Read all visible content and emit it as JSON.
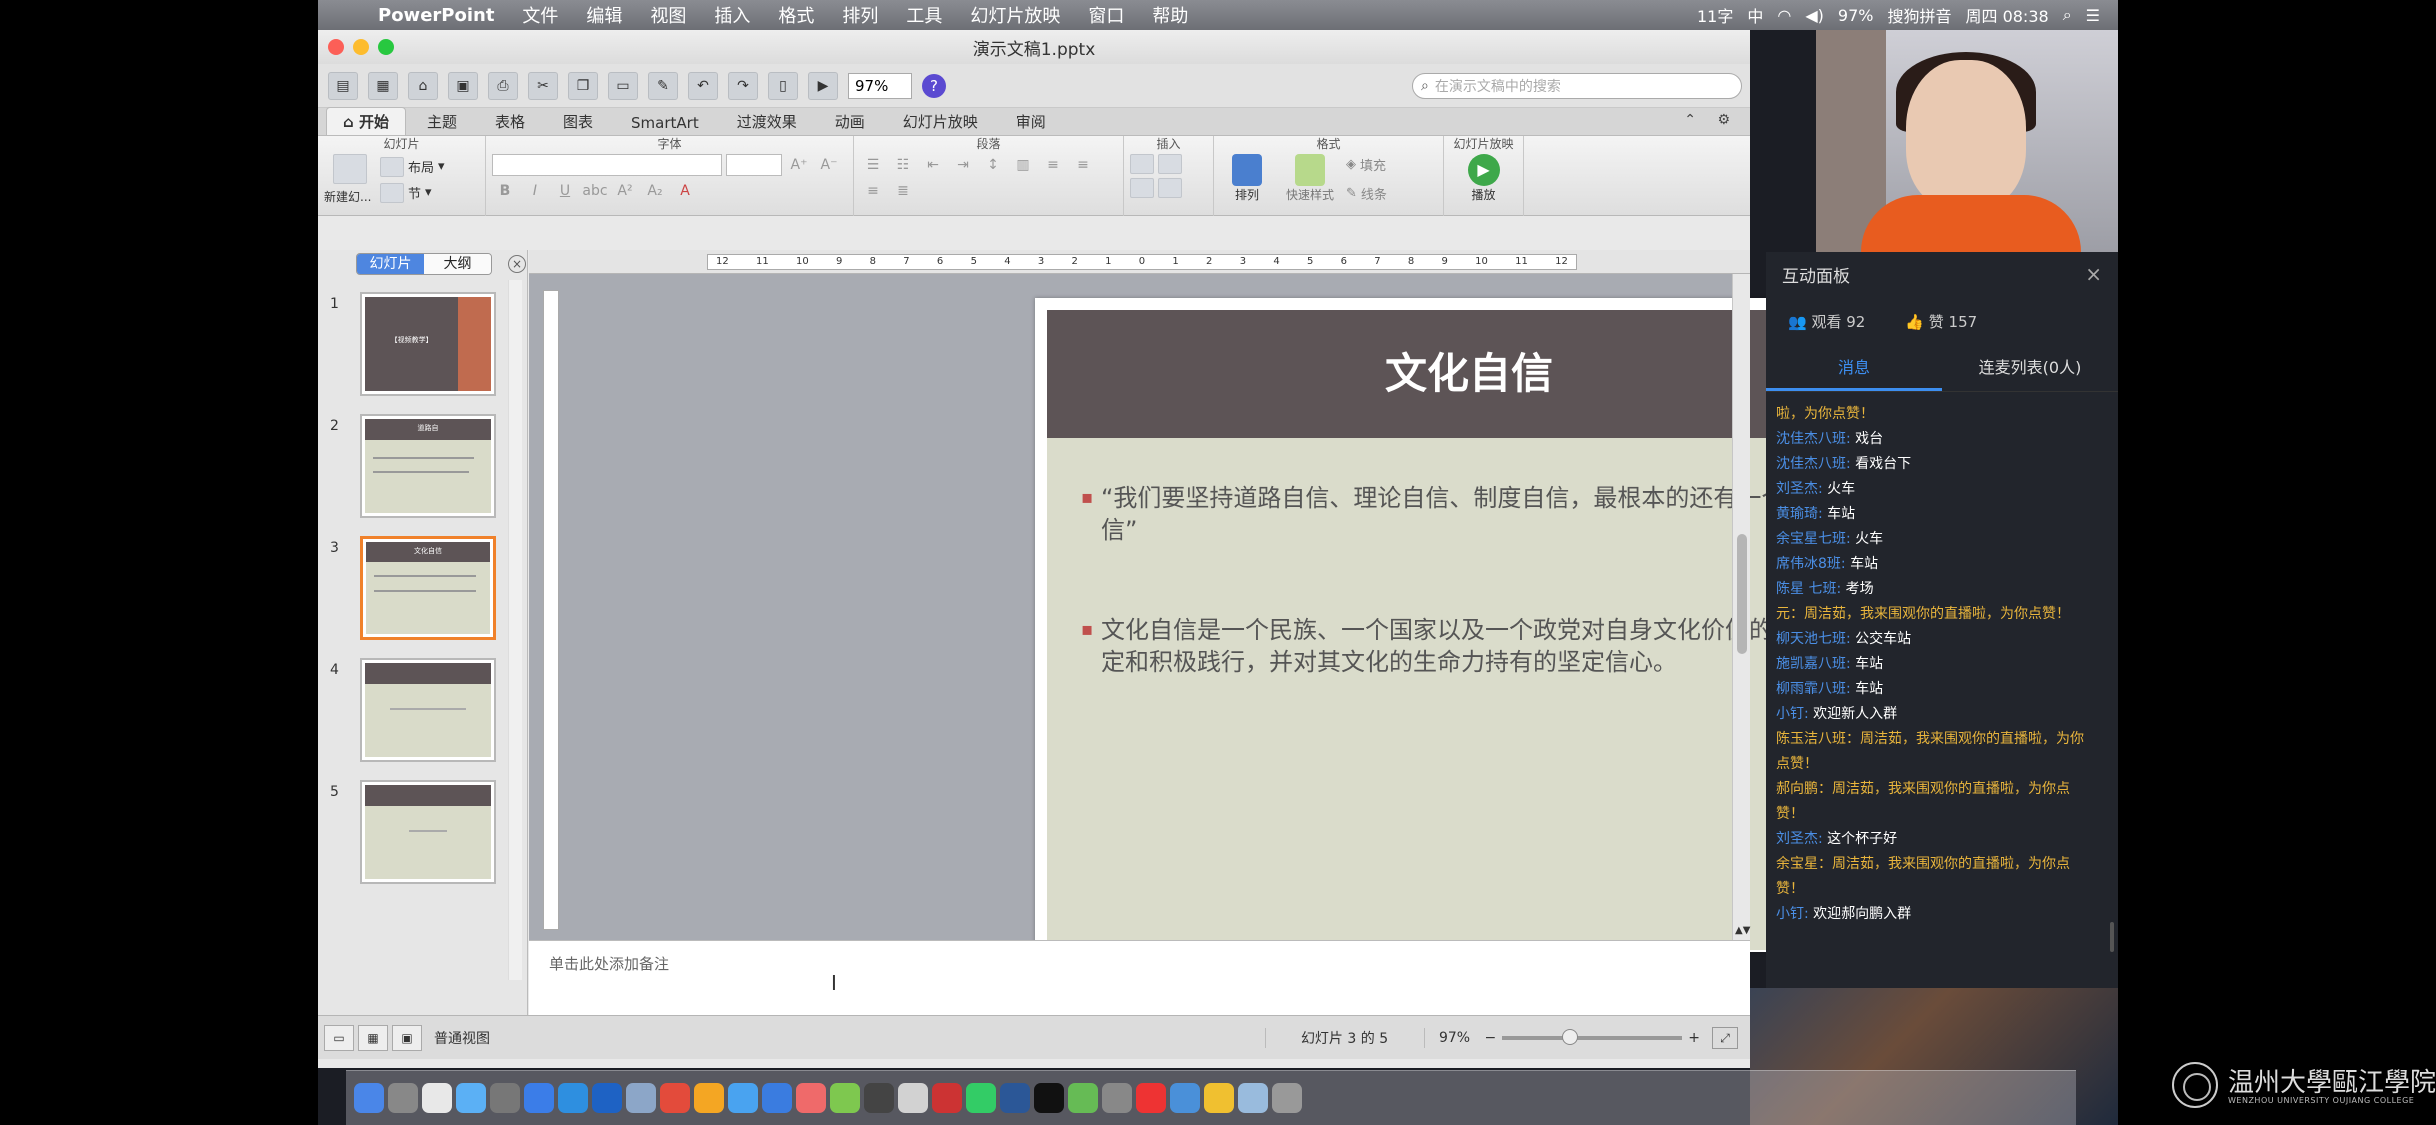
{
  "menubar": {
    "app_name": "PowerPoint",
    "items": [
      "文件",
      "编辑",
      "视图",
      "插入",
      "格式",
      "排列",
      "工具",
      "幻灯片放映",
      "窗口",
      "帮助"
    ],
    "right": {
      "word_count": "11字",
      "ime_mode": "中",
      "battery": "97%",
      "ime_name": "搜狗拼音",
      "clock": "周四 08:38"
    }
  },
  "window": {
    "title": "演示文稿1.pptx",
    "zoom_value": "97%",
    "search_placeholder": "在演示文稿中的搜索"
  },
  "ribbon": {
    "tabs": [
      "开始",
      "主题",
      "表格",
      "图表",
      "SmartArt",
      "过渡效果",
      "动画",
      "幻灯片放映",
      "审阅"
    ],
    "groups": {
      "slides": "幻灯片",
      "font": "字体",
      "paragraph": "段落",
      "insert": "插入",
      "format": "格式",
      "slideshow": "幻灯片放映"
    },
    "buttons": {
      "new_slide": "新建幻...",
      "layout": "布局",
      "section": "节",
      "arrange": "排列",
      "quick_styles": "快速样式",
      "fill": "填充",
      "line": "线条",
      "play": "播放"
    }
  },
  "sidebar": {
    "tab_slides": "幻灯片",
    "tab_outline": "大纲",
    "thumbnails": [
      {
        "num": "1",
        "title": "【视频教学】"
      },
      {
        "num": "2",
        "title": "道路自"
      },
      {
        "num": "3",
        "title": "文化自信"
      },
      {
        "num": "4",
        "title": ""
      },
      {
        "num": "5",
        "title": ""
      }
    ]
  },
  "slide": {
    "title": "文化自信",
    "bullets": [
      "“我们要坚持道路自信、理论自信、制度自信，最根本的还有一个文化自信”",
      "文化自信是一个民族、一个国家以及一个政党对自身文化价值的充分肯定和积极践行，并对其文化的生命力持有的坚定信心。"
    ]
  },
  "notes": {
    "placeholder": "单击此处添加备注"
  },
  "statusbar": {
    "view_label": "普通视图",
    "slide_counter": "幻灯片 3 的 5",
    "zoom": "97%"
  },
  "panel": {
    "title": "互动面板",
    "viewers": "观看 92",
    "likes": "赞 157",
    "tab_messages": "消息",
    "tab_connect": "连麦列表(0人)",
    "messages": [
      {
        "name": "",
        "text": "啦，为你点赞！",
        "sys": true
      },
      {
        "name": "沈佳杰八班:",
        "text": "戏台",
        "sys": false
      },
      {
        "name": "沈佳杰八班:",
        "text": "看戏台下",
        "sys": false
      },
      {
        "name": "刘圣杰:",
        "text": "火车",
        "sys": false
      },
      {
        "name": "黄瑜琦:",
        "text": "车站",
        "sys": false
      },
      {
        "name": "余宝星七班:",
        "text": "火车",
        "sys": false
      },
      {
        "name": "席伟冰8班:",
        "text": "车站",
        "sys": false
      },
      {
        "name": "陈星 七班:",
        "text": "考场",
        "sys": false
      },
      {
        "name": "元：",
        "text": "周洁茹，我来围观你的直播啦，为你点赞！",
        "sys": true
      },
      {
        "name": "柳天池七班:",
        "text": "公交车站",
        "sys": false
      },
      {
        "name": "施凯嘉八班:",
        "text": "车站",
        "sys": false
      },
      {
        "name": "柳雨霏八班:",
        "text": "车站",
        "sys": false
      },
      {
        "name": "小钉:",
        "text": "欢迎新人入群",
        "sys": false
      },
      {
        "name": "陈玉洁八班：",
        "text": "周洁茹，我来围观你的直播啦，为你点赞！",
        "sys": true
      },
      {
        "name": "郝向鹏：",
        "text": "周洁茹，我来围观你的直播啦，为你点赞！",
        "sys": true
      },
      {
        "name": "刘圣杰:",
        "text": "这个杯子好",
        "sys": false
      },
      {
        "name": "余宝星：",
        "text": "周洁茹，我来围观你的直播啦，为你点赞！",
        "sys": true
      },
      {
        "name": "小钉:",
        "text": "欢迎郝向鹏入群",
        "sys": false
      }
    ]
  },
  "watermark": {
    "cn": "温州大學甌江學院",
    "en": "WENZHOU UNIVERSITY OUJIANG COLLEGE"
  },
  "colors": {
    "slide_header": "#5d5456",
    "slide_body": "#dadccb",
    "bullet_marker": "#c0504d",
    "selection": "#f0812a",
    "panel_accent": "#3d8ef0"
  }
}
